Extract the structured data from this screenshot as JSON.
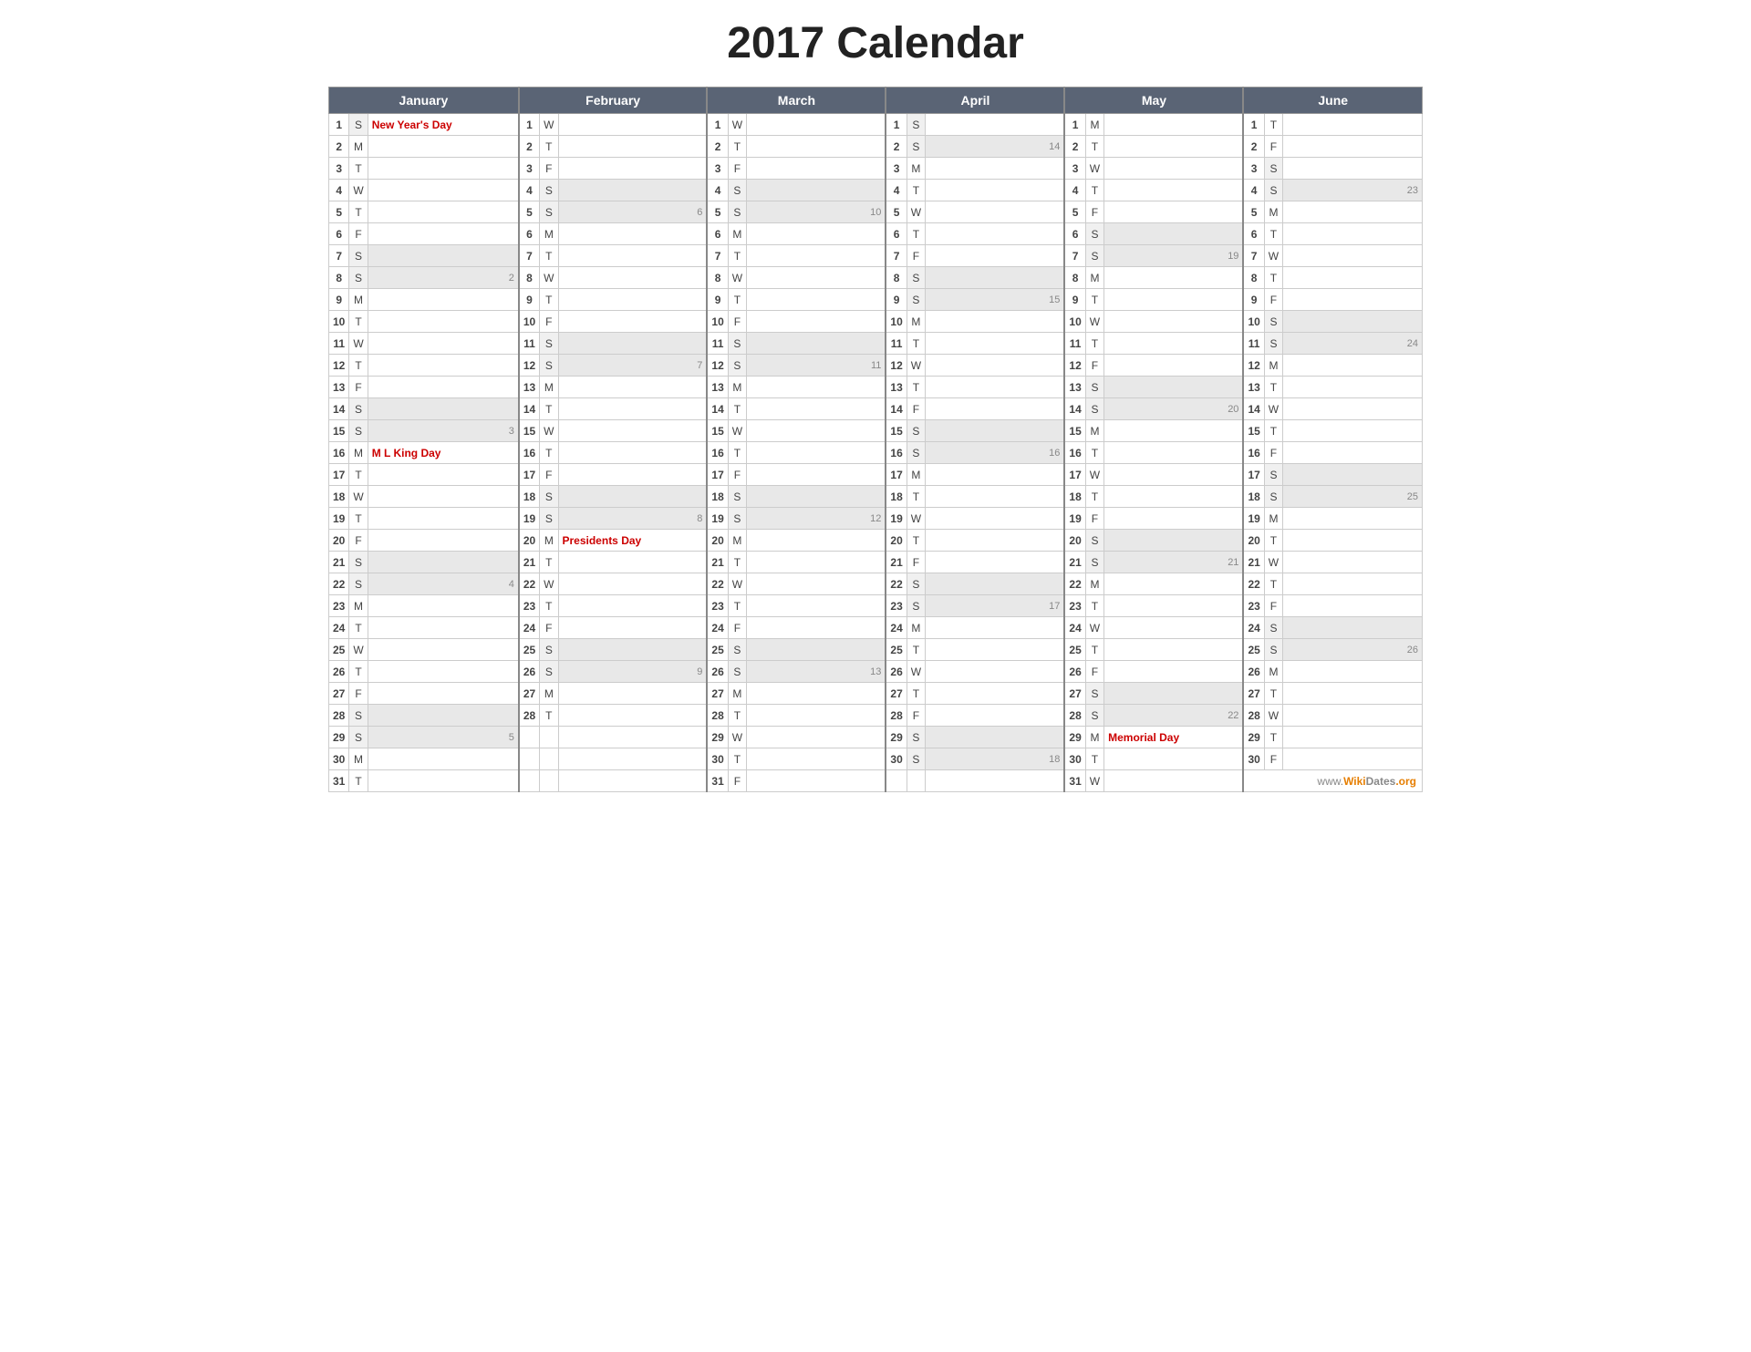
{
  "title": "2017 Calendar",
  "months": [
    "January",
    "February",
    "March",
    "April",
    "May",
    "June"
  ],
  "days_of_week": {
    "1": "S",
    "2": "M",
    "3": "T",
    "4": "W",
    "5": "T",
    "6": "F",
    "7": "S",
    "8": "S",
    "9": "M",
    "10": "T",
    "11": "W",
    "12": "T",
    "13": "F",
    "14": "S",
    "15": "S",
    "16": "M",
    "17": "T",
    "18": "W",
    "19": "T",
    "20": "F",
    "21": "S",
    "22": "S",
    "23": "M",
    "24": "T",
    "25": "W",
    "26": "T",
    "27": "F",
    "28": "S",
    "29": "S",
    "30": "M",
    "31": "T"
  },
  "footer": "www.WikiDates.org"
}
